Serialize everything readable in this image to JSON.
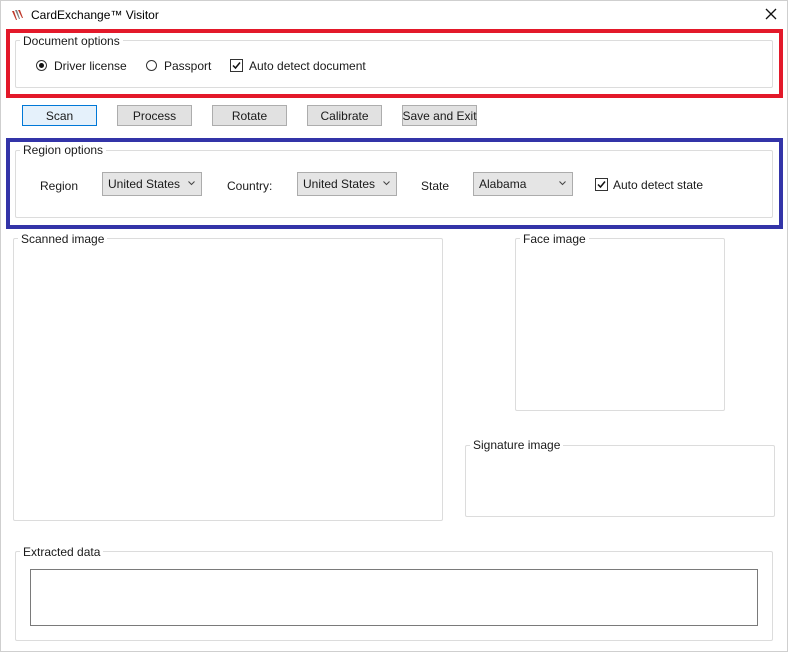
{
  "window": {
    "title": "CardExchange™ Visitor",
    "close_symbol": "✕",
    "icon": "cardexchange-logo-icon"
  },
  "document_options": {
    "legend": "Document options",
    "driver_license_label": "Driver license",
    "driver_license_checked": true,
    "passport_label": "Passport",
    "passport_checked": false,
    "auto_detect_label": "Auto detect document",
    "auto_detect_checked": true
  },
  "toolbar": {
    "scan_label": "Scan",
    "process_label": "Process",
    "rotate_label": "Rotate",
    "calibrate_label": "Calibrate",
    "save_exit_label": "Save and Exit"
  },
  "region_options": {
    "legend": "Region options",
    "region_label": "Region",
    "region_value": "United States",
    "country_label": "Country:",
    "country_value": "United States",
    "state_label": "State",
    "state_value": "Alabama",
    "auto_detect_state_label": "Auto detect state",
    "auto_detect_state_checked": true
  },
  "panels": {
    "scanned_image_legend": "Scanned image",
    "face_image_legend": "Face image",
    "signature_image_legend": "Signature image",
    "extracted_data_legend": "Extracted data"
  },
  "colors": {
    "highlight_red": "#e3192a",
    "highlight_blue": "#3334a8",
    "focus_blue": "#0078d7"
  }
}
